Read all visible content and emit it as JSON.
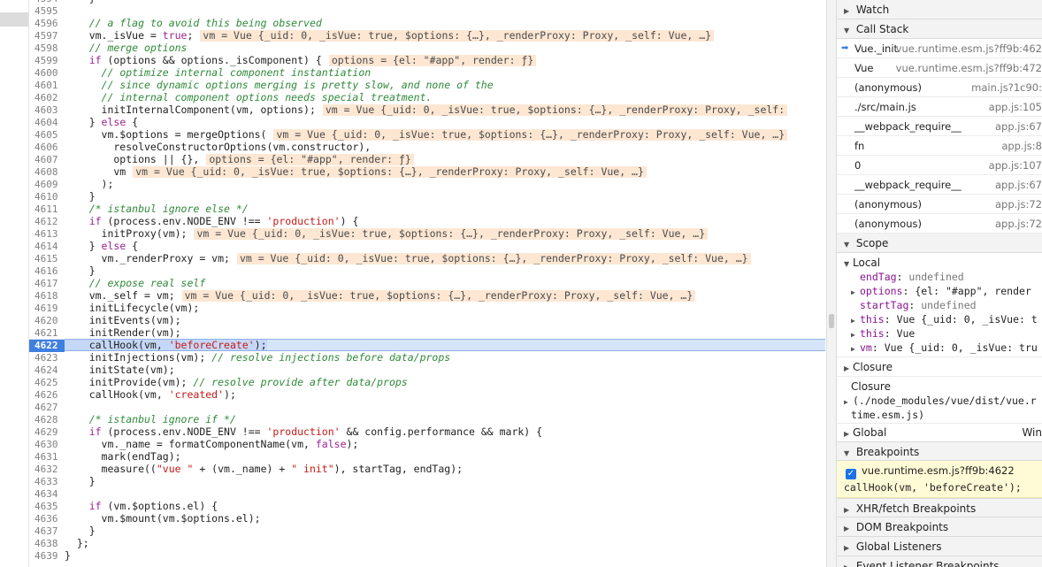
{
  "editor": {
    "current_line": 4622,
    "lines": [
      {
        "n": 4594,
        "html": "    }"
      },
      {
        "n": 4595,
        "html": ""
      },
      {
        "n": 4596,
        "html": "    <span class=\"c-cm\">// a flag to avoid this being observed</span>"
      },
      {
        "n": 4597,
        "html": "    vm._isVue = <span class=\"c-kw\">true</span>;",
        "inline": "vm = Vue {_uid: 0, _isVue: true, $options: {…}, _renderProxy: Proxy, _self: Vue, …}"
      },
      {
        "n": 4598,
        "html": "    <span class=\"c-cm\">// merge options</span>"
      },
      {
        "n": 4599,
        "html": "    <span class=\"c-kw\">if</span> (options &amp;&amp; options._isComponent) {",
        "inline": "options = {el: \"#app\", render: ƒ}"
      },
      {
        "n": 4600,
        "html": "      <span class=\"c-cm\">// optimize internal component instantiation</span>"
      },
      {
        "n": 4601,
        "html": "      <span class=\"c-cm\">// since dynamic options merging is pretty slow, and none of the</span>"
      },
      {
        "n": 4602,
        "html": "      <span class=\"c-cm\">// internal component options needs special treatment.</span>"
      },
      {
        "n": 4603,
        "html": "      initInternalComponent(vm, options);",
        "inline": "vm = Vue {_uid: 0, _isVue: true, $options: {…}, _renderProxy: Proxy, _self:"
      },
      {
        "n": 4604,
        "html": "    } <span class=\"c-kw\">else</span> {"
      },
      {
        "n": 4605,
        "html": "      vm.$options = mergeOptions(",
        "inline": "vm = Vue {_uid: 0, _isVue: true, $options: {…}, _renderProxy: Proxy, _self: Vue, …}"
      },
      {
        "n": 4606,
        "html": "        resolveConstructorOptions(vm.constructor),"
      },
      {
        "n": 4607,
        "html": "        options || {},",
        "inline": "options = {el: \"#app\", render: ƒ}"
      },
      {
        "n": 4608,
        "html": "        vm",
        "inline": "vm = Vue {_uid: 0, _isVue: true, $options: {…}, _renderProxy: Proxy, _self: Vue, …}"
      },
      {
        "n": 4609,
        "html": "      );"
      },
      {
        "n": 4610,
        "html": "    }"
      },
      {
        "n": 4611,
        "html": "    <span class=\"c-cm\">/* istanbul ignore else */</span>"
      },
      {
        "n": 4612,
        "html": "    <span class=\"c-kw\">if</span> (process.env.NODE_ENV !== <span class=\"c-str\">'production'</span>) {"
      },
      {
        "n": 4613,
        "html": "      initProxy(vm);",
        "inline": "vm = Vue {_uid: 0, _isVue: true, $options: {…}, _renderProxy: Proxy, _self: Vue, …}"
      },
      {
        "n": 4614,
        "html": "    } <span class=\"c-kw\">else</span> {"
      },
      {
        "n": 4615,
        "html": "      vm._renderProxy = vm;",
        "inline": "vm = Vue {_uid: 0, _isVue: true, $options: {…}, _renderProxy: Proxy, _self: Vue, …}"
      },
      {
        "n": 4616,
        "html": "    }"
      },
      {
        "n": 4617,
        "html": "    <span class=\"c-cm\">// expose real self</span>"
      },
      {
        "n": 4618,
        "html": "    vm._self = vm;",
        "inline": "vm = Vue {_uid: 0, _isVue: true, $options: {…}, _renderProxy: Proxy, _self: Vue, …}"
      },
      {
        "n": 4619,
        "html": "    initLifecycle(vm);"
      },
      {
        "n": 4620,
        "html": "    initEvents(vm);"
      },
      {
        "n": 4621,
        "html": "    initRender(vm);"
      },
      {
        "n": 4622,
        "html": "    callHook(vm, <span class=\"c-str\">'beforeCreate'</span>);"
      },
      {
        "n": 4623,
        "html": "    initInjections(vm); <span class=\"c-cm\">// resolve injections before data/props</span>"
      },
      {
        "n": 4624,
        "html": "    initState(vm);"
      },
      {
        "n": 4625,
        "html": "    initProvide(vm); <span class=\"c-cm\">// resolve provide after data/props</span>"
      },
      {
        "n": 4626,
        "html": "    callHook(vm, <span class=\"c-str\">'created'</span>);"
      },
      {
        "n": 4627,
        "html": ""
      },
      {
        "n": 4628,
        "html": "    <span class=\"c-cm\">/* istanbul ignore if */</span>"
      },
      {
        "n": 4629,
        "html": "    <span class=\"c-kw\">if</span> (process.env.NODE_ENV !== <span class=\"c-str\">'production'</span> &amp;&amp; config.performance &amp;&amp; mark) {"
      },
      {
        "n": 4630,
        "html": "      vm._name = formatComponentName(vm, <span class=\"c-kw\">false</span>);"
      },
      {
        "n": 4631,
        "html": "      mark(endTag);"
      },
      {
        "n": 4632,
        "html": "      measure((<span class=\"c-str\">\"vue \"</span> + (vm._name) + <span class=\"c-str\">\" init\"</span>), startTag, endTag);"
      },
      {
        "n": 4633,
        "html": "    }"
      },
      {
        "n": 4634,
        "html": ""
      },
      {
        "n": 4635,
        "html": "    <span class=\"c-kw\">if</span> (vm.$options.el) {"
      },
      {
        "n": 4636,
        "html": "      vm.$mount(vm.$options.el);"
      },
      {
        "n": 4637,
        "html": "    }"
      },
      {
        "n": 4638,
        "html": "  };"
      },
      {
        "n": 4639,
        "html": "}"
      }
    ]
  },
  "sidebar": {
    "watch_label": "Watch",
    "call_stack_label": "Call Stack",
    "call_stack": [
      {
        "name": "Vue._init",
        "loc": "vue.runtime.esm.js?ff9b:462",
        "active": true
      },
      {
        "name": "Vue",
        "loc": "vue.runtime.esm.js?ff9b:472"
      },
      {
        "name": "(anonymous)",
        "loc": "main.js?1c90:"
      },
      {
        "name": "./src/main.js",
        "loc": "app.js:105"
      },
      {
        "name": "__webpack_require__",
        "loc": "app.js:67"
      },
      {
        "name": "fn",
        "loc": "app.js:8"
      },
      {
        "name": "0",
        "loc": "app.js:107"
      },
      {
        "name": "__webpack_require__",
        "loc": "app.js:67"
      },
      {
        "name": "(anonymous)",
        "loc": "app.js:72"
      },
      {
        "name": "(anonymous)",
        "loc": "app.js:72"
      }
    ],
    "scope_label": "Scope",
    "local_label": "Local",
    "scope_end_tag_key": "endTag",
    "scope_end_tag_val": "undefined",
    "scope_options_key": "options",
    "scope_options_val": "{el: \"#app\", render",
    "scope_start_tag_key": "startTag",
    "scope_start_tag_val": "undefined",
    "scope_this1_key": "this",
    "scope_this1_val": "Vue {_uid: 0, _isVue: t",
    "scope_this2_key": "this",
    "scope_this2_val": "Vue",
    "scope_vm_key": "vm",
    "scope_vm_val": "Vue {_uid: 0, _isVue: tru",
    "closure_label": "Closure",
    "closure2_label": "Closure",
    "closure2_path": "(./node_modules/vue/dist/vue.r",
    "closure2_path2": "time.esm.js)",
    "global_label": "Global",
    "global_val": "Win",
    "breakpoints_label": "Breakpoints",
    "breakpoint_file": "vue.runtime.esm.js?ff9b:4622",
    "breakpoint_code": "callHook(vm, 'beforeCreate');",
    "xhr_label": "XHR/fetch Breakpoints",
    "dom_label": "DOM Breakpoints",
    "global_listeners_label": "Global Listeners",
    "event_listener_label": "Event Listener Breakpoints"
  }
}
